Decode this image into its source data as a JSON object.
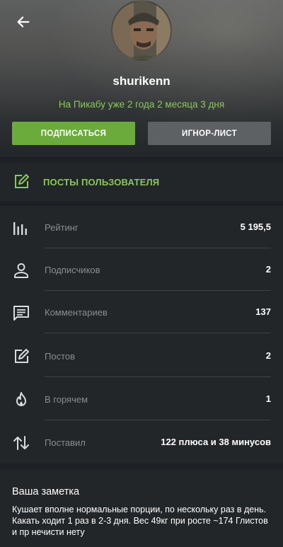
{
  "header": {
    "back_icon": "arrow-left-icon",
    "username": "shurikenn",
    "member_since": "На Пикабу уже 2 года 2 месяца 3 дня",
    "subscribe_label": "ПОДПИСАТЬСЯ",
    "ignore_label": "ИГНОР-ЛИСТ"
  },
  "posts_link": {
    "icon": "edit-icon",
    "label": "ПОСТЫ ПОЛЬЗОВАТЕЛЯ"
  },
  "stats": [
    {
      "icon": "bar-chart-icon",
      "label": "Рейтинг",
      "value": "5 195,5"
    },
    {
      "icon": "person-icon",
      "label": "Подписчиков",
      "value": "2"
    },
    {
      "icon": "comment-icon",
      "label": "Комментариев",
      "value": "137"
    },
    {
      "icon": "edit-icon",
      "label": "Постов",
      "value": "2"
    },
    {
      "icon": "fire-icon",
      "label": "В горячем",
      "value": "1"
    },
    {
      "icon": "up-down-arrows-icon",
      "label": "Поставил",
      "value": "122 плюса и 38 минусов"
    }
  ],
  "note": {
    "title": "Ваша заметка",
    "text": "Кушает вполне нормальные порции, по нескольку раз в день. Какать ходит 1 раз в 2-3 дня. Вес 49кг при росте ~174 Глистов и пр нечисти нету"
  },
  "colors": {
    "accent_green": "#8ac858",
    "subscribe_button": "#6aab3c",
    "ignore_button": "#5e6164",
    "panel_bg": "#232629",
    "page_bg": "#1d2024"
  }
}
